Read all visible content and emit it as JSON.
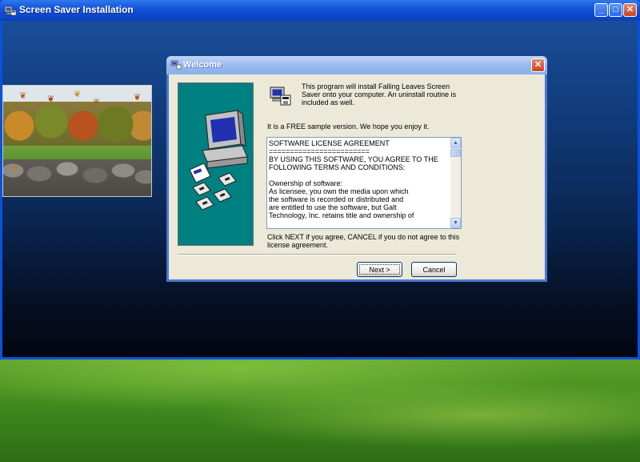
{
  "app": {
    "title": "Screen Saver Installation",
    "controls": {
      "minimize": "_",
      "maximize": "□",
      "close": "✕"
    }
  },
  "dialog": {
    "title": "Welcome",
    "close_glyph": "✕",
    "intro": "This program will install Falling Leaves Screen Saver onto your computer. An uninstall routine is included as well.",
    "free_note": "It is a FREE sample version. We hope you enjoy it.",
    "license_lines": [
      "SOFTWARE LICENSE AGREEMENT",
      "========================",
      "BY USING THIS SOFTWARE, YOU AGREE TO THE",
      "FOLLOWING TERMS AND CONDITIONS:",
      "",
      "Ownership of software:",
      "As licensee, you own the media upon which",
      "the software is recorded or distributed and",
      "are entitled to use the software, but Galt",
      "Technology, Inc. retains title and ownership of"
    ],
    "agree_text": "Click NEXT if you agree, CANCEL if you do not agree to this license agreement.",
    "next_label": "Next >",
    "cancel_label": "Cancel",
    "scroll_up": "▲",
    "scroll_down": "▼"
  },
  "icons": {
    "app": "screensaver-setup-icon",
    "setup": "installer-icon",
    "art": "computer-with-disks-illustration",
    "preview": "falling-leaves-preview"
  },
  "colors": {
    "xp_title_blue": "#0b45c8",
    "dialog_face": "#ece9d8",
    "art_teal": "#008080"
  }
}
